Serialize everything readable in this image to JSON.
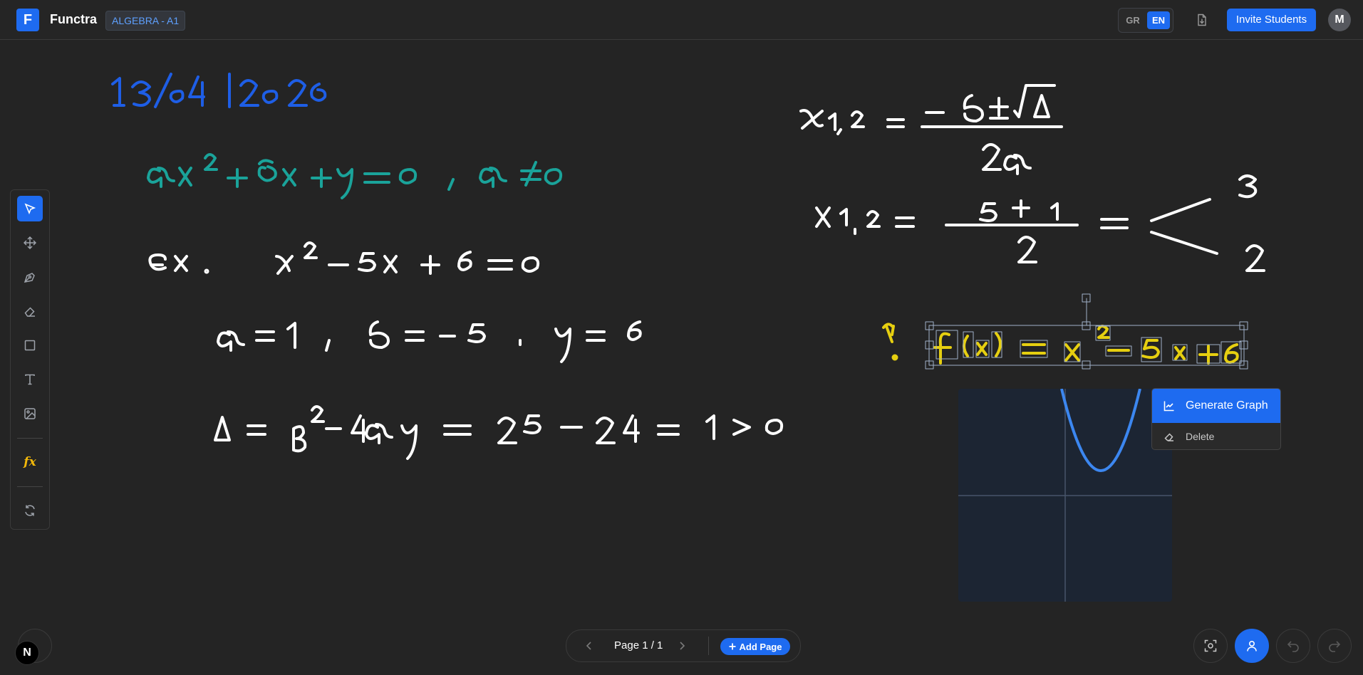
{
  "header": {
    "logo_letter": "F",
    "app_name": "Functra",
    "class_badge": "ALGEBRA - A1",
    "lang_options": [
      "GR",
      "EN"
    ],
    "lang_selected": "EN",
    "download_icon": "file-download-icon",
    "invite_label": "Invite Students",
    "avatar_initial": "M"
  },
  "toolbar": {
    "tools": [
      {
        "name": "select",
        "icon": "cursor-arrow-icon",
        "active": true
      },
      {
        "name": "move",
        "icon": "move-arrows-icon"
      },
      {
        "name": "pen",
        "icon": "pen-nib-icon"
      },
      {
        "name": "eraser",
        "icon": "eraser-icon"
      },
      {
        "name": "rectangle",
        "icon": "rectangle-icon"
      },
      {
        "name": "text",
        "icon": "text-t-icon"
      },
      {
        "name": "image",
        "icon": "image-icon"
      },
      {
        "name": "function",
        "icon": "fx-icon",
        "label": "fx"
      },
      {
        "name": "refresh",
        "icon": "refresh-icon"
      }
    ]
  },
  "context_menu": {
    "generate_label": "Generate Graph",
    "generate_icon": "line-chart-icon",
    "delete_label": "Delete",
    "delete_icon": "eraser-icon"
  },
  "pager": {
    "page_label": "Page 1 / 1",
    "add_page_label": "Add Page"
  },
  "bottom_right": {
    "buttons": [
      "focus-capture-icon",
      "user-icon",
      "undo-icon",
      "redo-icon"
    ]
  },
  "n_badge": "N",
  "colors": {
    "accent": "#1e6bf0",
    "ink_white": "#ffffff",
    "ink_blue": "#1e5ee6",
    "ink_teal": "#1aa39a",
    "ink_yellow": "#e6cf10",
    "graph_curve": "#3c87f0",
    "canvas_bg": "#242424"
  }
}
